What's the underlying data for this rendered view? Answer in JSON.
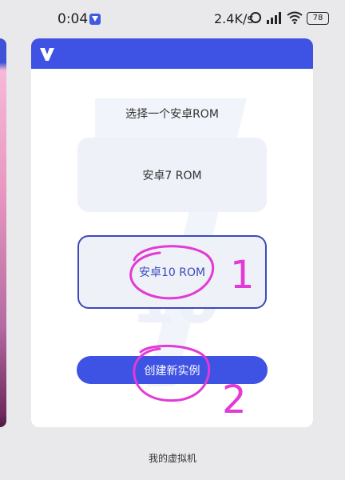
{
  "status_bar": {
    "time": "0:04",
    "network_speed": "2.4K/s",
    "battery": "78"
  },
  "dialog": {
    "title": "选择一个安卓ROM",
    "options": [
      {
        "label": "安卓7 ROM",
        "selected": false
      },
      {
        "label": "安卓10 ROM",
        "selected": true
      }
    ],
    "create_button": "创建新实例"
  },
  "annotations": {
    "mark_1": "1",
    "mark_2": "2",
    "color": "#e23ad6"
  },
  "footer": {
    "label": "我的虚拟机"
  },
  "colors": {
    "accent": "#3e52e3",
    "selected_border": "#3d4bb8",
    "annotation": "#e23ad6"
  }
}
